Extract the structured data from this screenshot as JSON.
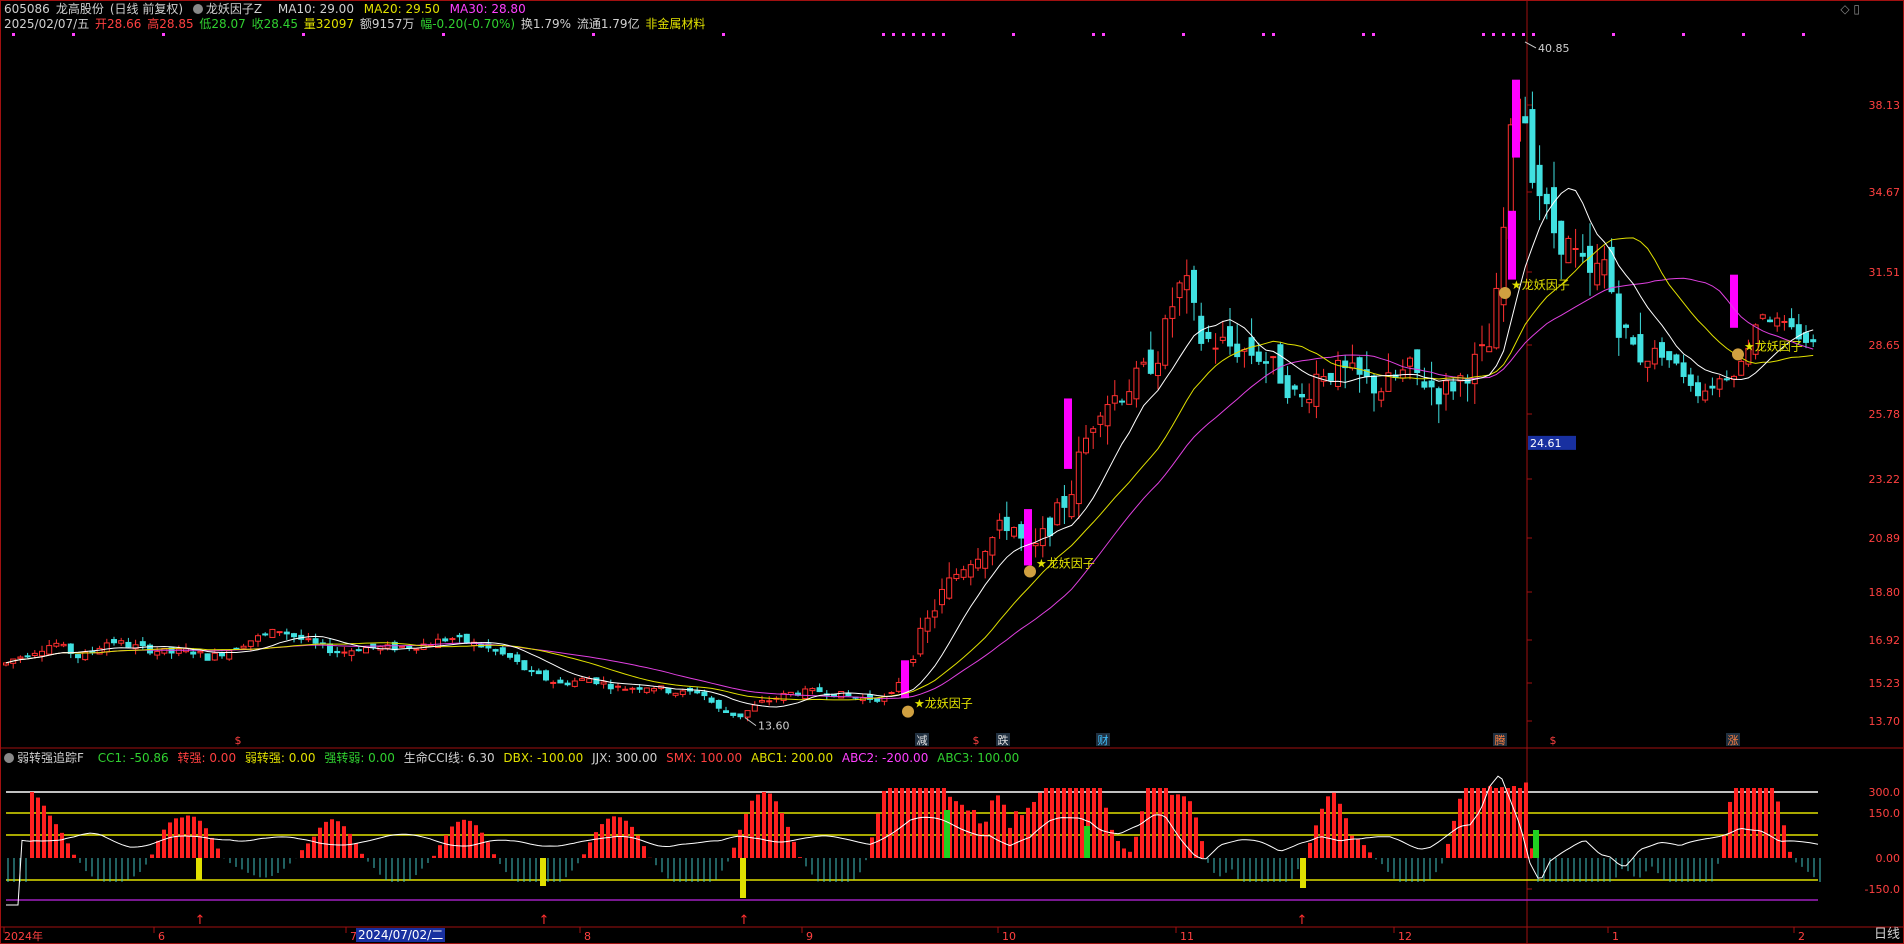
{
  "stock": {
    "code": "605086",
    "name": "龙高股份",
    "mode": "(日线 前复权)",
    "indicator": "龙妖因子Z",
    "ma10": "MA10: 29.00",
    "ma20": "MA20: 29.50",
    "ma30": "MA30: 28.80"
  },
  "quote": {
    "date": "2025/02/07/五",
    "open": "开28.66",
    "high": "高28.85",
    "low": "低28.07",
    "close": "收28.45",
    "volume": "量32097",
    "amount": "额9157万",
    "change": "幅-0.20(-0.70%)",
    "turnover": "换1.79%",
    "float_cap": "流通1.79亿",
    "sector": "非金属材料"
  },
  "price_axis": [
    "38.13",
    "34.67",
    "31.51",
    "28.65",
    "25.78",
    "23.22",
    "20.89",
    "18.80",
    "16.92",
    "15.23",
    "13.70"
  ],
  "price_highlight": "24.61",
  "high_label": "40.85",
  "low_label": "13.60",
  "signal_label": "★龙妖因子",
  "event_markers": [
    "减",
    "跌",
    "财",
    "腾",
    "涨"
  ],
  "sub": {
    "name": "弱转强追踪F",
    "cc1": "CC1: -50.86",
    "zhuanqiang": "转强: 0.00",
    "ruozhuanqiang": "弱转强: 0.00",
    "qiangzhuanruo": "强转弱: 0.00",
    "cci": "生命CCI线: 6.30",
    "dbx": "DBX: -100.00",
    "jjx": "JJX: 300.00",
    "smx": "SMX: 100.00",
    "abc1": "ABC1: 200.00",
    "abc2": "ABC2: -200.00",
    "abc3": "ABC3: 100.00",
    "axis": [
      "300.0",
      "150.0",
      "0.00",
      "-150.0"
    ]
  },
  "time_axis": [
    "2024年",
    "6",
    "7",
    "8",
    "9",
    "10",
    "11",
    "12",
    "1",
    "2"
  ],
  "cursor_date": "2024/07/02/二",
  "period": "日线",
  "colors": {
    "up": "#ff3030",
    "down": "#40e0e0",
    "ma10": "#ffffff",
    "ma20": "#e0e000",
    "ma30": "#e040e0",
    "signal": "#ff00ff"
  }
}
